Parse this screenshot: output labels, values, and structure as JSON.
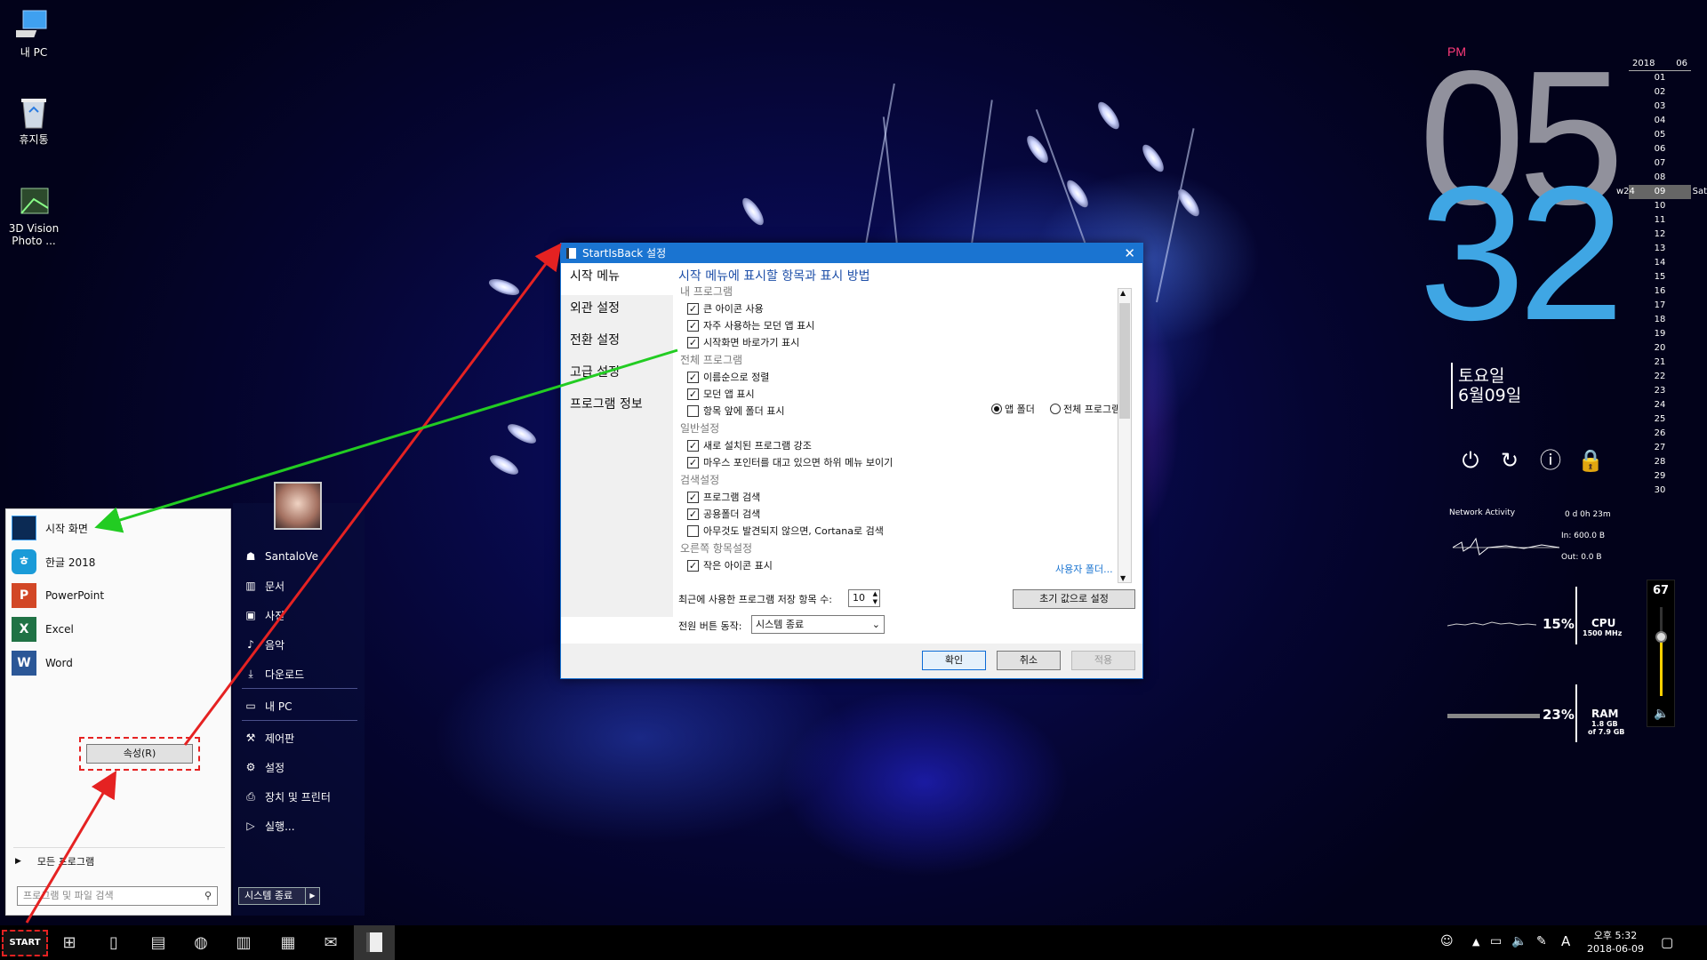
{
  "desktop": {
    "icons": [
      {
        "label": "내 PC"
      },
      {
        "label": "휴지통"
      },
      {
        "label": "3D Vision Photo ..."
      }
    ]
  },
  "clock": {
    "ampm": "PM",
    "hour": "05",
    "minute": "32",
    "weekday": "토요일",
    "date": "6월09일"
  },
  "calendar": {
    "year": "2018",
    "month": "06",
    "week": "w24",
    "today_name": "Sat",
    "days": [
      "01",
      "02",
      "03",
      "04",
      "05",
      "06",
      "07",
      "08",
      "09",
      "10",
      "11",
      "12",
      "13",
      "14",
      "15",
      "16",
      "17",
      "18",
      "19",
      "20",
      "21",
      "22",
      "23",
      "24",
      "25",
      "26",
      "27",
      "28",
      "29",
      "30"
    ]
  },
  "network": {
    "title": "Network Activity",
    "uptime": "0 d 0h 23m",
    "in": "In: 600.0 B",
    "out": "Out: 0.0 B"
  },
  "cpu": {
    "percent": "15%",
    "label": "CPU",
    "sub": "1500 MHz"
  },
  "ram": {
    "percent": "23%",
    "label": "RAM",
    "sub1": "1.8 GB",
    "sub2": "of 7.9 GB"
  },
  "volume": {
    "value": "67",
    "level": 0.67
  },
  "dialog": {
    "title": "StartIsBack 설정",
    "nav": [
      "시작 메뉴",
      "외관 설정",
      "전환 설정",
      "고급 설정",
      "프로그램 정보"
    ],
    "heading": "시작 메뉴에 표시할 항목과 표시 방법",
    "sections": {
      "my_programs": "내 프로그램",
      "all_programs": "전체 프로그램",
      "general": "일반설정",
      "search": "검색설정",
      "right": "오른쪽 항목설정"
    },
    "checks": {
      "large_icons": "큰 아이콘 사용",
      "frequent_modern": "자주 사용하는 모던 앱 표시",
      "start_shortcut": "시작화면 바로가기 표시",
      "sort_by_name": "이름순으로 정렬",
      "modern_apps": "모던 앱 표시",
      "folders_first": "항목 앞에 폴더 표시",
      "highlight_new": "새로 설치된 프로그램 강조",
      "hover_submenu": "마우스 포인터를 대고 있으면 하위 메뉴 보이기",
      "search_programs": "프로그램 검색",
      "search_shared": "공용폴더 검색",
      "cortana": "아무것도 발견되지 않으면, Cortana로 검색",
      "cut_off": "작은 아이콘 표시"
    },
    "radio_app_folder": "앱 폴더",
    "radio_all_programs": "전체 프로그램",
    "user_folders_link": "사용자 폴더...",
    "recent_label": "최근에 사용한 프로그램 저장 항목 수:",
    "recent_value": "10",
    "reset_button": "초기 값으로 설정",
    "power_label": "전원 버튼 동작:",
    "power_value": "시스템 종료",
    "ok": "확인",
    "cancel": "취소",
    "apply": "적용"
  },
  "start_menu": {
    "apps": [
      "시작 화면",
      "한글 2018",
      "PowerPoint",
      "Excel",
      "Word"
    ],
    "properties_button": "속성(R)",
    "all_programs": "모든 프로그램",
    "search_placeholder": "프로그램 및 파일 검색",
    "right_items": [
      "SantaloVe",
      "문서",
      "사진",
      "음악",
      "다운로드",
      "내 PC",
      "제어판",
      "설정",
      "장치 및 프린터",
      "실행..."
    ],
    "shutdown": "시스템 종료"
  },
  "taskbar": {
    "start_label": "START",
    "ime": "A",
    "time": "오후 5:32",
    "date": "2018-06-09"
  },
  "colors": {
    "accent": "#1a74d1",
    "clock_minute": "#3fa6e4",
    "pm": "#ff3b7a",
    "arrow_red": "#e52222",
    "arrow_green": "#22cc22"
  }
}
